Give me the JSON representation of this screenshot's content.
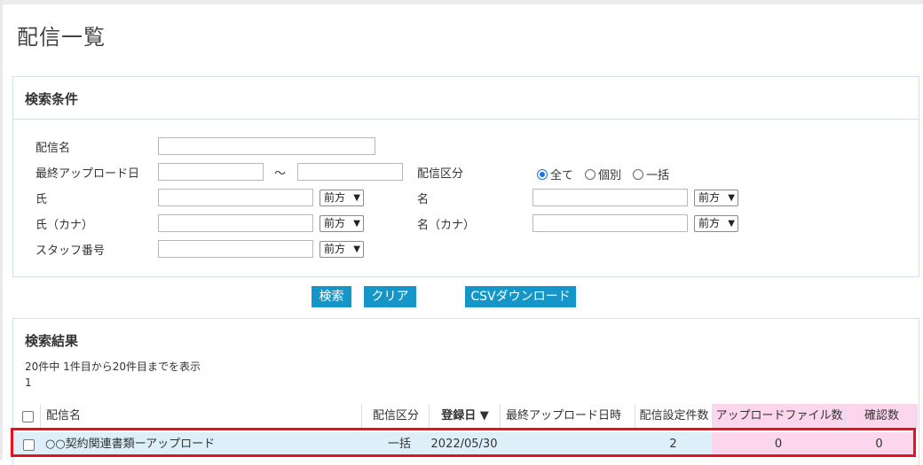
{
  "page_title": "配信一覧",
  "search": {
    "header": "検索条件",
    "labels": {
      "haishin_name": "配信名",
      "last_upload": "最終アップロード日",
      "range_sep": "～",
      "haishin_kubun": "配信区分",
      "sei": "氏",
      "mei": "名",
      "sei_kana": "氏（カナ）",
      "mei_kana": "名（カナ）",
      "staff_no": "スタッフ番号"
    },
    "radio_options": [
      "全て",
      "個別",
      "一括"
    ],
    "radio_selected": "全て",
    "match_select_value": "前方",
    "buttons": {
      "search": "検索",
      "clear": "クリア",
      "csv": "CSVダウンロード"
    }
  },
  "results": {
    "header": "検索結果",
    "count_text": "20件中 1件目から20件目までを表示",
    "page_number": "1",
    "columns": [
      "配信名",
      "配信区分",
      "登録日 ▼",
      "最終アップロード日時",
      "配信設定件数",
      "アップロードファイル数",
      "確認数"
    ],
    "rows": [
      {
        "name": "○○契約関連書類ーアップロード",
        "kubun": "一括",
        "registered": "2022/05/30",
        "last_upload": "",
        "settings_count": "2",
        "file_count": "0",
        "confirm_count": "0"
      }
    ]
  },
  "colors": {
    "button": "#1596c8",
    "highlight": "#e8121f",
    "row_bg": "#ddf0fa",
    "pink": "#fbd6ec"
  }
}
